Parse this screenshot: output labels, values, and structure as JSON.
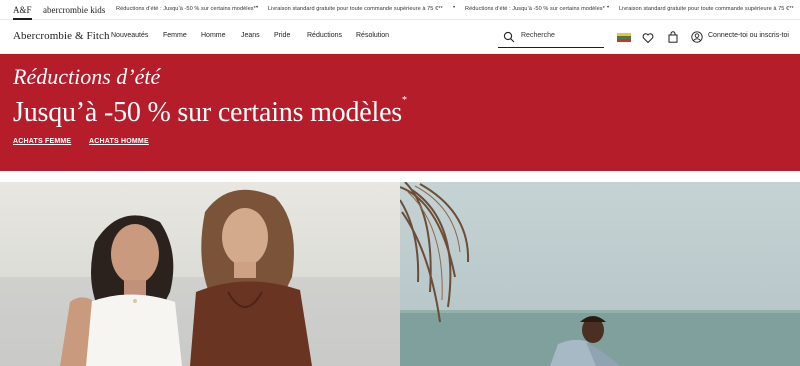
{
  "topbar": {
    "brand_af": "A&F",
    "brand_kids": "abercrombie kids",
    "ticker": [
      "Réductions d’été : Jusqu’à -50 % sur certains modèles*",
      "Livraison standard gratuite pour toute commande supérieure à 75 €**",
      "Réductions d’été : Jusqu’à -50 % sur certains modèles*",
      "Livraison standard gratuite pour toute commande supérieure à 75 €**"
    ],
    "separator": "•"
  },
  "nav": {
    "logo": "Abercrombie & Fitch",
    "links": [
      "Nouveautés",
      "Femme",
      "Homme",
      "Jeans",
      "Pride",
      "Réductions",
      "Résolution"
    ],
    "search_placeholder": "Recherche",
    "signin": "Connecte-toi ou inscris-toi",
    "flag_colors": [
      "#e8c547",
      "#4e7b3c",
      "#c8323a"
    ]
  },
  "hero": {
    "subtitle": "Réductions d’été",
    "title": "Jusqu’à -50 % sur certains modèles",
    "title_mark": "*",
    "links": [
      "ACHATS FEMME",
      "ACHATS HOMME"
    ],
    "background": "#b61d2b"
  },
  "icons": {
    "search": "search-icon",
    "wishlist": "heart-icon",
    "bag": "shopping-bag-icon",
    "account": "user-icon"
  }
}
